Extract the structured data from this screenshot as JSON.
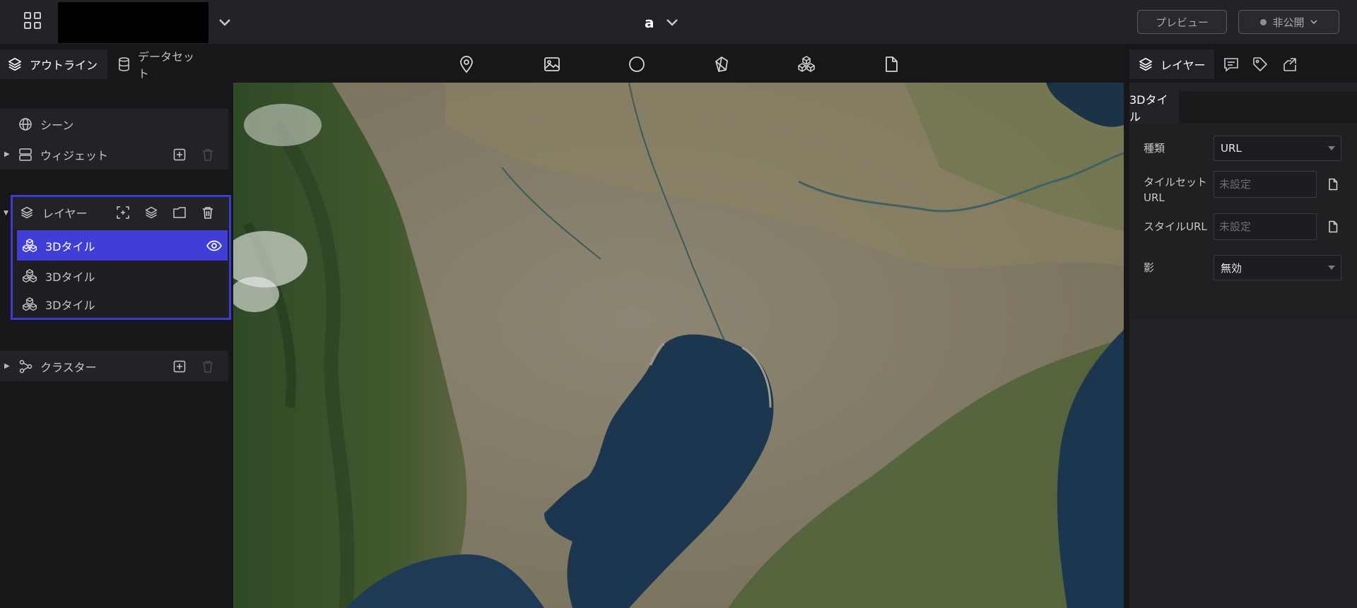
{
  "header": {
    "project_name": "a",
    "preview_label": "プレビュー",
    "publish_status_label": "非公開"
  },
  "left_tabs": {
    "outline_label": "アウトライン",
    "dataset_label": "データセット"
  },
  "toolbar": {
    "icons": [
      "marker-icon",
      "image-icon",
      "circle-icon",
      "polygon-3d-icon",
      "3d-tiles-icon",
      "file-icon"
    ]
  },
  "outline": {
    "scene_label": "シーン",
    "widget_label": "ウィジェット",
    "layer_group_label": "レイヤー",
    "layers": [
      {
        "label": "3Dタイル",
        "selected": true,
        "visible": true
      },
      {
        "label": "3Dタイル",
        "selected": false
      },
      {
        "label": "3Dタイル",
        "selected": false
      }
    ],
    "cluster_label": "クラスター"
  },
  "right_panel": {
    "tab_label": "レイヤー",
    "subtab_label": "3Dタイル",
    "fields": {
      "type_label": "種類",
      "type_value": "URL",
      "tileset_label": "タイルセット URL",
      "tileset_placeholder": "未設定",
      "style_label": "スタイルURL",
      "style_placeholder": "未設定",
      "shadow_label": "影",
      "shadow_value": "無効"
    }
  },
  "colors": {
    "accent": "#3f3fd8",
    "topbar": "#232226",
    "background": "#171618",
    "sea": "#1c3650"
  }
}
